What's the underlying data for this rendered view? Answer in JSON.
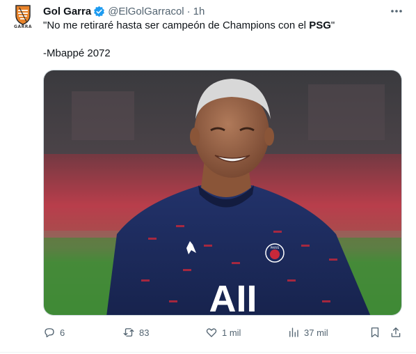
{
  "tweet": {
    "avatar_text": "GARRA",
    "display_name": "Gol Garra",
    "handle": "@ElGolGarracol",
    "separator": "·",
    "time": "1h",
    "text_line1_before": "\"No me retiraré hasta ser campeón de Champions con el ",
    "text_line1_bold": "PSG",
    "text_line1_after": "\"",
    "text_line2": "-Mbappé 2072",
    "media_shirt_text": "AII",
    "media_badge_text": "PARIS"
  },
  "actions": {
    "replies": "6",
    "retweets": "83",
    "likes": "1 mil",
    "views": "37 mil"
  },
  "colors": {
    "text": "#0f1419",
    "muted": "#536471",
    "verified": "#1d9bf0",
    "shirt": "#1b2a5e",
    "pitch": "#3f8a36",
    "stand_red": "#c8283a"
  }
}
